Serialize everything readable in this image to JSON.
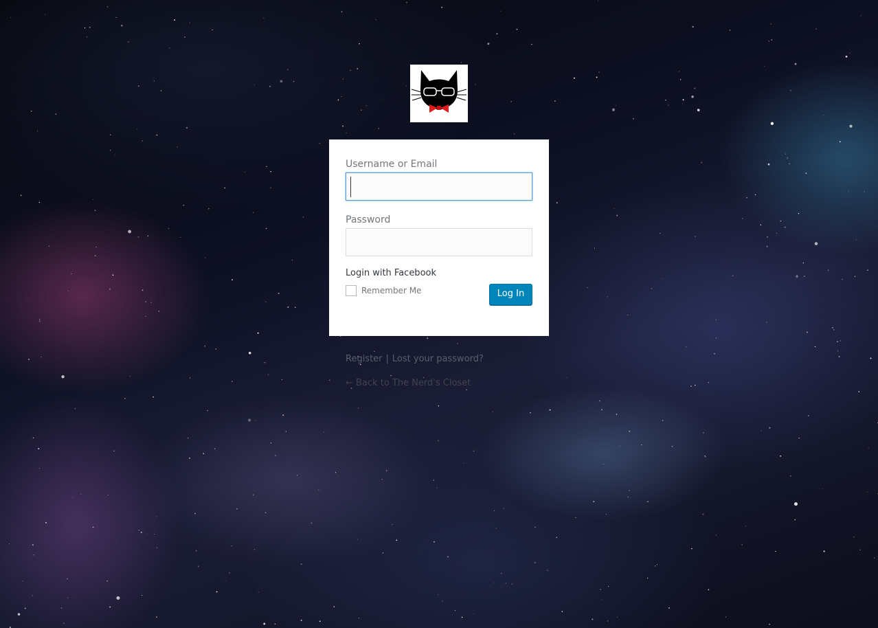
{
  "logo": {
    "icon": "cat-with-sunglasses-and-bow-tie-icon"
  },
  "form": {
    "username_label": "Username or Email",
    "username_value": "",
    "password_label": "Password",
    "password_value": "",
    "facebook_link": "Login with Facebook",
    "remember_label": "Remember Me",
    "remember_checked": false,
    "submit_label": "Log In"
  },
  "nav": {
    "register": "Register",
    "separator": "|",
    "lost_password": "Lost your password?"
  },
  "back_link": "← Back to The Nerd's Closet",
  "colors": {
    "button": "#0085ba",
    "focus_border": "#5b9dd9",
    "panel": "#ffffff"
  }
}
